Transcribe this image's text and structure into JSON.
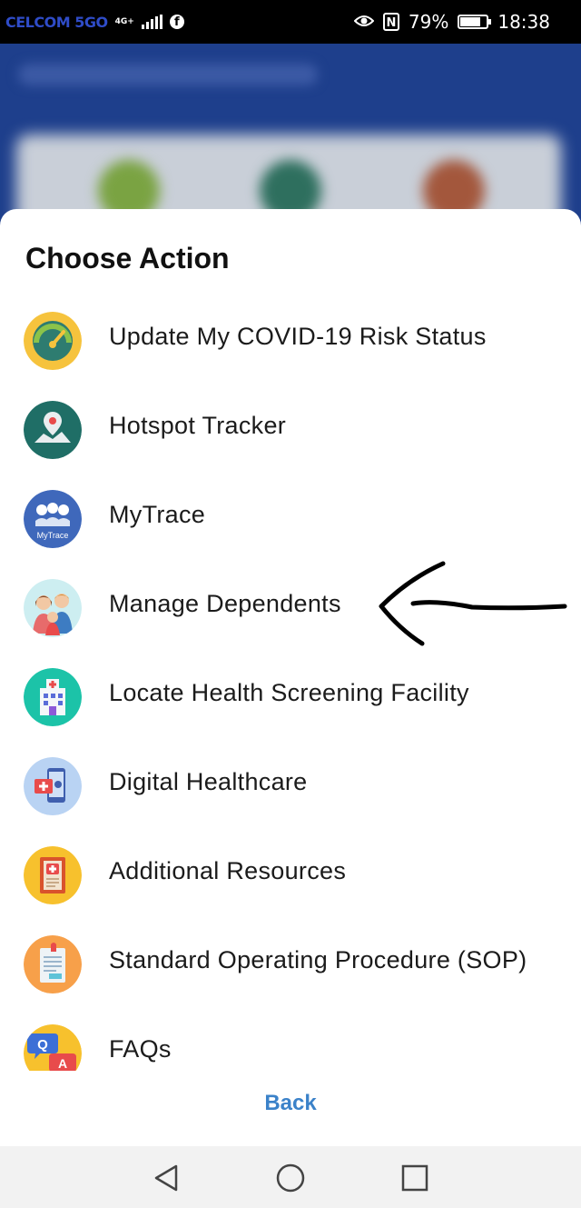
{
  "status_bar": {
    "carrier": "CELCOM 5GO",
    "network": "4G+",
    "battery": "79%",
    "battery_level": 0.79,
    "time": "18:38",
    "icons": [
      "signal-icon",
      "facebook-icon",
      "eye-icon",
      "nfc-icon",
      "battery-icon"
    ]
  },
  "sheet": {
    "title": "Choose Action",
    "items": [
      {
        "label": "Update My COVID-19 Risk Status",
        "icon": "risk-gauge-icon"
      },
      {
        "label": "Hotspot Tracker",
        "icon": "map-pin-icon"
      },
      {
        "label": "MyTrace",
        "icon": "mytrace-icon",
        "icon_text": "MyTrace"
      },
      {
        "label": "Manage Dependents",
        "icon": "family-icon"
      },
      {
        "label": "Locate Health Screening Facility",
        "icon": "hospital-icon"
      },
      {
        "label": "Digital Healthcare",
        "icon": "phone-medical-icon"
      },
      {
        "label": "Additional Resources",
        "icon": "medical-book-icon"
      },
      {
        "label": "Standard Operating Procedure (SOP)",
        "icon": "clipboard-icon"
      },
      {
        "label": "FAQs",
        "icon": "qa-chat-icon",
        "icon_text": [
          "Q",
          "A"
        ]
      }
    ],
    "back_label": "Back"
  },
  "colors": {
    "link_blue": "#3b82c9",
    "app_blue": "#1e3f8c"
  },
  "nav_bar": {
    "buttons": [
      "back-triangle-icon",
      "home-circle-icon",
      "recents-square-icon"
    ]
  }
}
